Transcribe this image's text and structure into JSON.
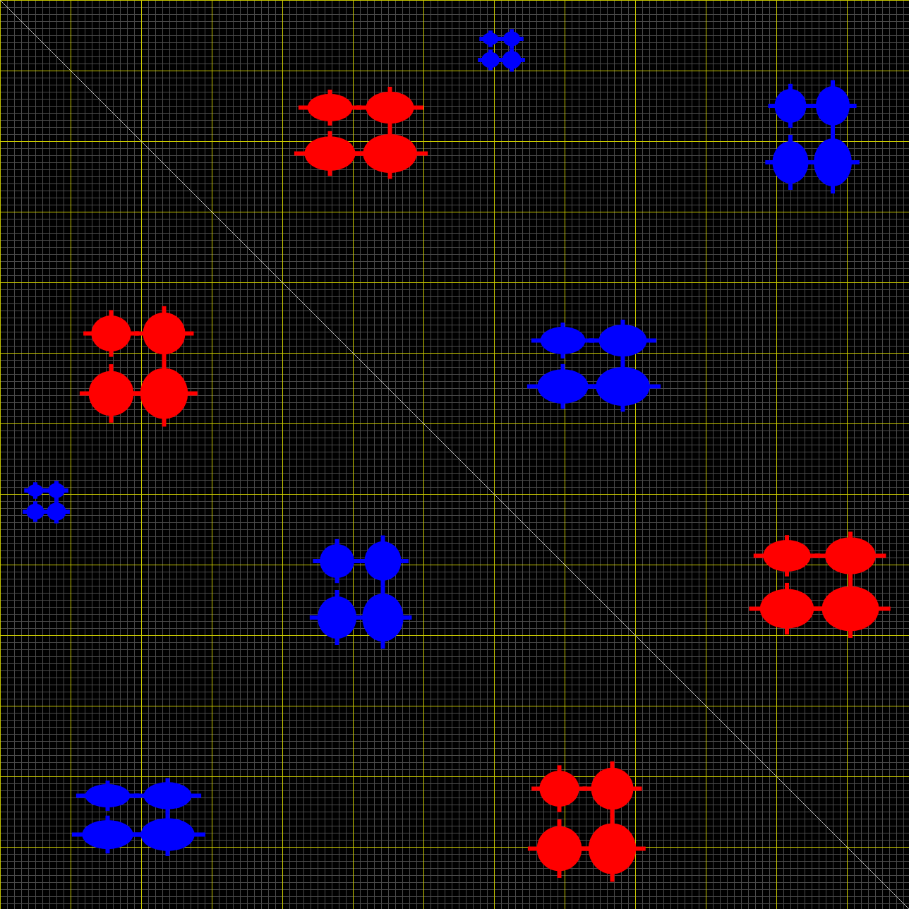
{
  "plot": {
    "clusters": [
      {
        "color": "#ff0000"
      },
      {
        "color": "#ff0000"
      },
      {
        "color": "#ff0000"
      },
      {
        "color": "#ff0000"
      },
      {
        "color": "#0000ff"
      },
      {
        "color": "#0000ff"
      },
      {
        "color": "#0000ff"
      },
      {
        "color": "#0000ff"
      },
      {
        "color": "#0000ff"
      },
      {
        "color": "#0000ff"
      }
    ]
  }
}
